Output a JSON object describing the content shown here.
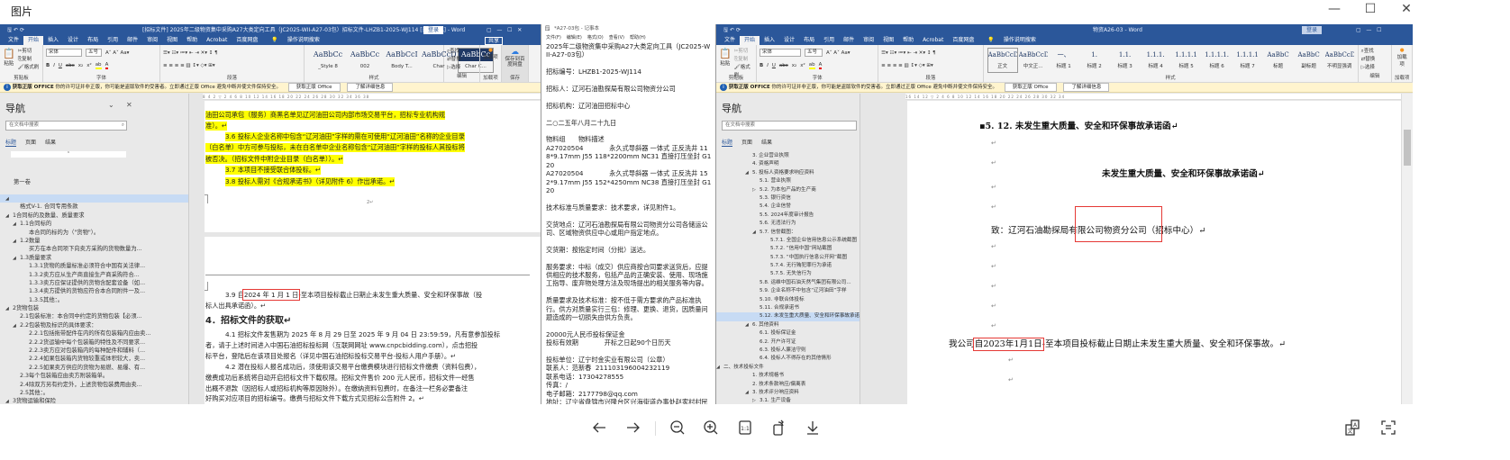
{
  "viewer": {
    "title": "图片",
    "controls": {
      "minimize": "—",
      "maximize": "☐",
      "close": "✕"
    }
  },
  "left_word": {
    "title": "[招标文件] 2025年二级物资集中采购A27大类定向工具（JC2025-WII-A27-03包）招标文件-LHZB1-2025-WJ114 [兼容模式] - Word",
    "login": "登录",
    "share": "共享",
    "tabs": [
      "文件",
      "开始",
      "插入",
      "设计",
      "布局",
      "引用",
      "邮件",
      "审阅",
      "视图",
      "帮助",
      "Acrobat",
      "百度网盘",
      "操作说明搜索"
    ],
    "clipboard": {
      "paste": "粘贴",
      "cut": "剪切",
      "copy": "复制",
      "format_painter": "格式刷",
      "label": "剪贴板"
    },
    "font": {
      "name": "宋体",
      "size": "五号",
      "label": "字体"
    },
    "paragraph_label": "段落",
    "styles": [
      {
        "sample": "AaBbCc",
        "name": "_Style 8"
      },
      {
        "sample": "AaBbCc",
        "name": "002"
      },
      {
        "sample": "AaBbCcI",
        "name": "Body T..."
      },
      {
        "sample": "AaBbCcDc",
        "name": "Char"
      },
      {
        "sample": "AaBbCc",
        "name": "Char C..."
      }
    ],
    "styles_label": "样式",
    "editing": {
      "find": "查找",
      "replace": "替换",
      "select": "选择",
      "label": "编辑"
    },
    "addins": {
      "btn": "加载项",
      "label": "加载项"
    },
    "save": {
      "btn": "保存到百度网盘",
      "label": "保存"
    },
    "nav": {
      "title": "导航",
      "search_placeholder": "在文档中搜索",
      "tabs": [
        "标题",
        "页面",
        "结果"
      ],
      "chapter": "第一卷",
      "items": [
        {
          "t": "",
          "lvl": 0,
          "tri": "◢",
          "sel": true
        },
        {
          "t": "格式V-1. 合同专用条款",
          "lvl": 1,
          "tri": ""
        },
        {
          "t": "1合同标的及数量、质量要求",
          "lvl": 0,
          "tri": "◢"
        },
        {
          "t": "1.1合同标的",
          "lvl": 1,
          "tri": "◢"
        },
        {
          "t": "本合同的标的为（\"货物\"）。",
          "lvl": 2,
          "tri": ""
        },
        {
          "t": "1.2数量",
          "lvl": 1,
          "tri": "◢"
        },
        {
          "t": "买方在本合同项下向卖方采购的货物数量为...",
          "lvl": 2,
          "tri": ""
        },
        {
          "t": "1.3质量要求",
          "lvl": 1,
          "tri": "◢"
        },
        {
          "t": "1.3.1货物的质量标准必须符合中国有关法律...",
          "lvl": 2,
          "tri": ""
        },
        {
          "t": "1.3.2卖方应从生产商直接生产商采购符合...",
          "lvl": 2,
          "tri": ""
        },
        {
          "t": "1.3.3卖方应保证提供的货物含配套设备（如...",
          "lvl": 2,
          "tri": ""
        },
        {
          "t": "1.3.4卖方提供的货物应符合本合同附件一及...",
          "lvl": 2,
          "tri": ""
        },
        {
          "t": "1.3.5其他：。",
          "lvl": 2,
          "tri": ""
        },
        {
          "t": "2货物包装",
          "lvl": 0,
          "tri": "◢"
        },
        {
          "t": "2.1包装标准：本合同中约定的货物包装【必须...",
          "lvl": 1,
          "tri": ""
        },
        {
          "t": "2.2包装物及标识的具体要求：",
          "lvl": 1,
          "tri": "◢"
        },
        {
          "t": "2.2.1包括拖带配件在内的所有包装箱内应由卖...",
          "lvl": 2,
          "tri": ""
        },
        {
          "t": "2.2.2货运输中每个包装箱的特性及不同要求...",
          "lvl": 2,
          "tri": ""
        },
        {
          "t": "2.2.3卖方应对包装箱内的每种配件和辅料（...",
          "lvl": 2,
          "tri": ""
        },
        {
          "t": "2.2.4如果包装箱内货物较重或体积较大，卖...",
          "lvl": 2,
          "tri": ""
        },
        {
          "t": "2.2.5如果卖方供应的货物为易燃、易爆、有...",
          "lvl": 2,
          "tri": ""
        },
        {
          "t": "2.3每个包装箱应由卖方附装箱单。",
          "lvl": 1,
          "tri": ""
        },
        {
          "t": "2.4除双方另有约定外，上述货物包装费用由卖...",
          "lvl": 1,
          "tri": ""
        },
        {
          "t": "2.5其他：。",
          "lvl": 1,
          "tri": ""
        },
        {
          "t": "3货物运输和保险",
          "lvl": 0,
          "tri": "◢"
        },
        {
          "t": "3.1运输方式：本合同下货物运输方式为【铁路...",
          "lvl": 1,
          "tri": ""
        },
        {
          "t": "3.2保险条款",
          "lvl": 1,
          "tri": ""
        }
      ]
    },
    "page1_lines": [
      "油田公司承包（服务）商黑名单见辽河油田公司内部市场交易平台，招标专业机构规",
      "准）。↵",
      "3.6 投标人企业名称中包含“辽河油田”字样的需在可使用“辽河油田”名称的企业目录",
      "（白名单）中方可参与投标，未在白名单中企业名称包含“辽河油田”字样的投标人其投标将",
      "被否决。（招标文件中附企业目录（白名单））。↵",
      "3.7 本项目不接受联合体投标。↵",
      "3.8 投标人需对《合规承诺书》（详见附件 6）作出承诺。↵"
    ],
    "page_number": "2↵",
    "p39_prefix": "3.9 自",
    "p39_date": "2024 年 1 月 1 日",
    "p39_suffix": "-至本项目投标截止日期止未发生重大质量、安全和环保事故（投",
    "p39_cont": "标人出具承诺函）。↵",
    "heading4": "4．招标文件的获取↵",
    "page2_lines": [
      "4.1 招标文件发售期为 2025 年 8 月 29 日至 2025 年 9 月 04 日 23:59:59，凡有意参加投标",
      "者，请于上述时间进入中国石油招标投标网（互联网网址 www.cnpcbidding.com），点击招投",
      "标平台，登陆后在该项目处报名（详见中国石油招标投标交易平台-投标人用户手册）。↵",
      "4.2 潜在投标人报名成功后，须使用该交易平台缴费模块进行招标文件缴费（资料包费），",
      "缴费成功后系统将自动开启招标文件下载权限。招标文件售价 200 元人民币，招标文件一经售",
      "出概不退款（因招标人或招标机构等原因除外）。在缴纳资料包费时，在备注一栏务必要备注",
      "好购买对应项目的招标编号。缴费与招标文件下载方式见招标公告附件 2。↵"
    ]
  },
  "info_bar": {
    "title": "获取正版 OFFICE",
    "message": "你的许可证并非正版，你可能是盗版软件的受害者。立即通过正版 Office 避免中断并使文件保持安全。",
    "get_genuine": "获取正版 Office",
    "learn_more": "了解详细信息"
  },
  "notepad": {
    "title": "*A27-03包 - 记事本",
    "menu": [
      "文件(F)",
      "编辑(E)",
      "格式(O)",
      "查看(V)",
      "帮助(H)"
    ],
    "text": "2025年二级物资集中采购A27大类定向工具（JC2025-WII-A27-03包）\n\n招标编号：LHZB1-2025-WJ114\n\n招标人：辽河石油勘探局有限公司物资分公司\n\n招标机构：辽河油田招标中心\n\n二○二五年八月二十九日\n\n物料组　　物料描述\nA27020504　　　　永久式导斜器 一体式 正反洗井 118*9.17mm J55 118*2200mm NC31 直接打压坐封 G120\nA27020504　　　　永久式导斜器 一体式 正反洗井 152*9.17mm J55 152*4250mm NC38 直接打压坐封 G120\n\n技术标准与质量要求：技术要求，详见附件1。\n\n交货地点：辽河石油勘探局有限公司物资分公司各储运公司、区域物资供应中心或用户指定地点。\n\n交货期：按指定时间（分批）送达。\n\n服务要求：中标（成交）供应商按合同要求送货后，应提供相应的技术服务，包括产品的正确安装、使用、现场施工指导、废弃物处理方法及现场提出的相关服务等内容。\n\n质量要求及技术标准：按不低于需方要求的产品标准执行。供方对质量实行三包：修理、更换、退货，因质量问题造成的一切损失由供方负责。\n\n20000元人民币投标保证金\n投标有效期　　　　开标之日起90个日历天\n\n投标单位：辽宁时金实业有限公司（公章）\n联系人：范新春  211103196004232119\n联系电话：17304278555\n传真：/\n电子邮箱：2177798@qq.com\n地址：辽宁省盘锦市兴隆台区兴海街道办事处赵家村村民委员会1-6-125（8楼-804室）（经营场所：辽宁省盘锦市兴隆台区兴隆开发区1-4-133-C）\n编制日期：2025年9月8日"
  },
  "right_word": {
    "title": "物资A26-03 - Word",
    "login": "登录",
    "tabs": [
      "文件",
      "开始",
      "插入",
      "设计",
      "布局",
      "引用",
      "邮件",
      "审阅",
      "视图",
      "帮助",
      "Acrobat",
      "百度网盘",
      "操作说明搜索"
    ],
    "styles": [
      {
        "sample": "AaBbCcDdI",
        "name": "正文"
      },
      {
        "sample": "AaBbCcD",
        "name": "中文正..."
      },
      {
        "sample": "一、",
        "name": "标题 1"
      },
      {
        "sample": "1.",
        "name": "标题 2"
      },
      {
        "sample": "1.1.",
        "name": "标题 3"
      },
      {
        "sample": "1.1.1.",
        "name": "标题 4"
      },
      {
        "sample": "1.1.1.1",
        "name": "标题 5"
      },
      {
        "sample": "1.1.1.1.",
        "name": "标题 6"
      },
      {
        "sample": "1.1.1.1",
        "name": "标题 7"
      },
      {
        "sample": "AaBbC",
        "name": "标题"
      },
      {
        "sample": "AaBbC",
        "name": "副标题"
      },
      {
        "sample": "AaBbCcD",
        "name": "不明显强调"
      }
    ],
    "nav": {
      "title": "导航",
      "search_placeholder": "在文档中搜索",
      "tabs": [
        "标题",
        "页面",
        "结果"
      ],
      "items": [
        {
          "t": "3. 企业营业执照",
          "lvl": 1,
          "tri": ""
        },
        {
          "t": "4. 资格声明",
          "lvl": 1,
          "tri": ""
        },
        {
          "t": "5. 投标人资格要求响应资料",
          "lvl": 1,
          "tri": "◢"
        },
        {
          "t": "5.1. 营业执照",
          "lvl": 2,
          "tri": ""
        },
        {
          "t": "5.2. 为本包产品的生产商",
          "lvl": 2,
          "tri": "▷"
        },
        {
          "t": "5.3. 银行资信",
          "lvl": 2,
          "tri": ""
        },
        {
          "t": "5.4. 企业信誉",
          "lvl": 2,
          "tri": ""
        },
        {
          "t": "5.5. 2024年度审计报告",
          "lvl": 2,
          "tri": ""
        },
        {
          "t": "5.6. 无违法行为",
          "lvl": 2,
          "tri": ""
        },
        {
          "t": "5.7. 信誉截图：",
          "lvl": 2,
          "tri": "◢"
        },
        {
          "t": "5.7.1. 全国企业信用信息公示系统截图",
          "lvl": 3,
          "tri": ""
        },
        {
          "t": "5.7.2. “信用中国”网站截图",
          "lvl": 3,
          "tri": ""
        },
        {
          "t": "5.7.3. “中国执行信息公开网”截图",
          "lvl": 3,
          "tri": ""
        },
        {
          "t": "5.7.4. 无行贿犯罪行为承诺",
          "lvl": 3,
          "tri": ""
        },
        {
          "t": "5.7.5. 无失信行为",
          "lvl": 3,
          "tri": ""
        },
        {
          "t": "5.8. 运维中国石油天然气集团有限公司...",
          "lvl": 2,
          "tri": ""
        },
        {
          "t": "5.9. 企业名称不中包含“辽河油田”字样",
          "lvl": 2,
          "tri": ""
        },
        {
          "t": "5.10. 非联合体投标",
          "lvl": 2,
          "tri": ""
        },
        {
          "t": "5.11. 合规承诺书",
          "lvl": 2,
          "tri": ""
        },
        {
          "t": "5.12. 未发生重大质量、安全和环保事故承诺函",
          "lvl": 2,
          "tri": "",
          "sel": true
        },
        {
          "t": "6. 其他资料",
          "lvl": 1,
          "tri": "◢"
        },
        {
          "t": "6.1. 投标保证金",
          "lvl": 2,
          "tri": ""
        },
        {
          "t": "6.2. 开户许可证",
          "lvl": 2,
          "tri": ""
        },
        {
          "t": "6.3. 投标人廉洁守则",
          "lvl": 2,
          "tri": ""
        },
        {
          "t": "6.4. 投标人不得存在的其他情形",
          "lvl": 2,
          "tri": ""
        },
        {
          "t": "二、技术投标文件",
          "lvl": 0,
          "tri": "◢"
        },
        {
          "t": "1. 技术规格书",
          "lvl": 1,
          "tri": ""
        },
        {
          "t": "2. 技术条款响应/偏离表",
          "lvl": 1,
          "tri": ""
        },
        {
          "t": "3. 技术评分响应资料",
          "lvl": 1,
          "tri": "◢"
        },
        {
          "t": "3.1. 生产设备",
          "lvl": 2,
          "tri": "▷"
        },
        {
          "t": "3.2. 检验设备",
          "lvl": 2,
          "tri": "▷"
        }
      ]
    },
    "doc": {
      "section_heading": "▪5. 12. 未发生重大质量、安全和环保事故承诺函↵",
      "title": "未发生重大质量、安全和环保事故承诺函↵",
      "to_prefix": "致：辽河石油勘探局有限公司物资分公司",
      "to_highlight": "（招标中心）↵",
      "stmt_prefix": "我公司",
      "stmt_date": "自2023年1月1日",
      "stmt_suffix": "-至本项目投标截止日期止未发生重大质量、安全和环保事故。↵",
      "return_mark": "↵"
    }
  },
  "toolbar": {
    "prev": "previous-image",
    "next": "next-image",
    "zoom_out": "zoom-out",
    "zoom_in": "zoom-in",
    "actual_size": "1:1",
    "rotate": "rotate",
    "download": "download",
    "translate": "translate",
    "ocr": "extract-text"
  },
  "colors": {
    "word_blue": "#2b579a",
    "highlight": "#ffff00",
    "annotation_red": "#e53935",
    "info_bar": "#fff4ce",
    "nav_selected": "#c7dbf4"
  }
}
